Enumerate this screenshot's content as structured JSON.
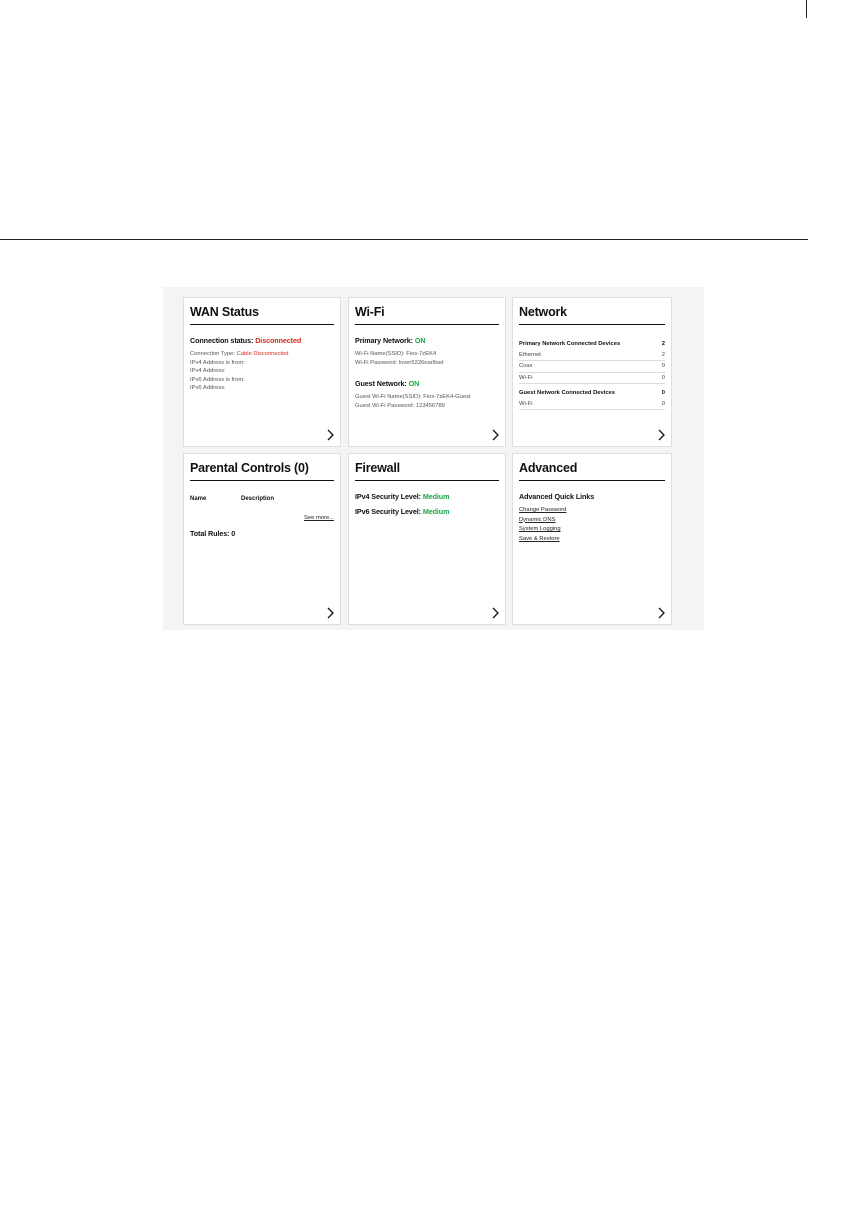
{
  "colors": {
    "disconnected": "#d52b1e",
    "on": "#1aa64a",
    "dashboard_bg": "#f4f4f4"
  },
  "wan": {
    "title": "WAN Status",
    "connection_status_label": "Connection status:",
    "connection_status_value": "Disconnected",
    "connection_type_label": "Connection Type:",
    "connection_type_value": "Cable Disconnected",
    "ipv4_from": "IPv4 Address is from:",
    "ipv4_address": "IPv4 Address:",
    "ipv6_from": "IPv6 Address is from:",
    "ipv6_address": "IPv6 Address:"
  },
  "wifi": {
    "title": "Wi-Fi",
    "primary_label": "Primary Network:",
    "primary_state": "ON",
    "ssid_line": "Wi-Fi Name(SSID): Fios-7zEK4",
    "password_line": "Wi-Fi Password: lover5226ear8set",
    "guest_label": "Guest Network:",
    "guest_state": "ON",
    "guest_ssid_line": "Guest Wi-Fi Name(SSID): Fios-7zEK4-Guest",
    "guest_password_line": "Guest Wi-Fi Password: 123456789"
  },
  "network": {
    "title": "Network",
    "primary_header": "Primary Network Connected Devices",
    "primary_total": "2",
    "primary_rows": [
      {
        "label": "Ethernet",
        "value": "2"
      },
      {
        "label": "Coax",
        "value": "0"
      },
      {
        "label": "Wi-Fi",
        "value": "0"
      }
    ],
    "guest_header": "Guest Network Connected Devices",
    "guest_total": "0",
    "guest_rows": [
      {
        "label": "Wi-Fi",
        "value": "0"
      }
    ]
  },
  "parental": {
    "title": "Parental Controls (0)",
    "col_name": "Name",
    "col_description": "Description",
    "see_more": "See more...",
    "total_rules": "Total Rules: 0"
  },
  "firewall": {
    "title": "Firewall",
    "ipv4_label": "IPv4 Security Level:",
    "ipv4_value": "Medium",
    "ipv6_label": "IPv6 Security Level:",
    "ipv6_value": "Medium"
  },
  "advanced": {
    "title": "Advanced",
    "quick_links_header": "Advanced Quick Links",
    "links": [
      "Change Password",
      "Dynamic DNS",
      "System Logging",
      "Save & Restore"
    ]
  },
  "icons": {
    "card_arrow": "chevron-right-icon"
  }
}
